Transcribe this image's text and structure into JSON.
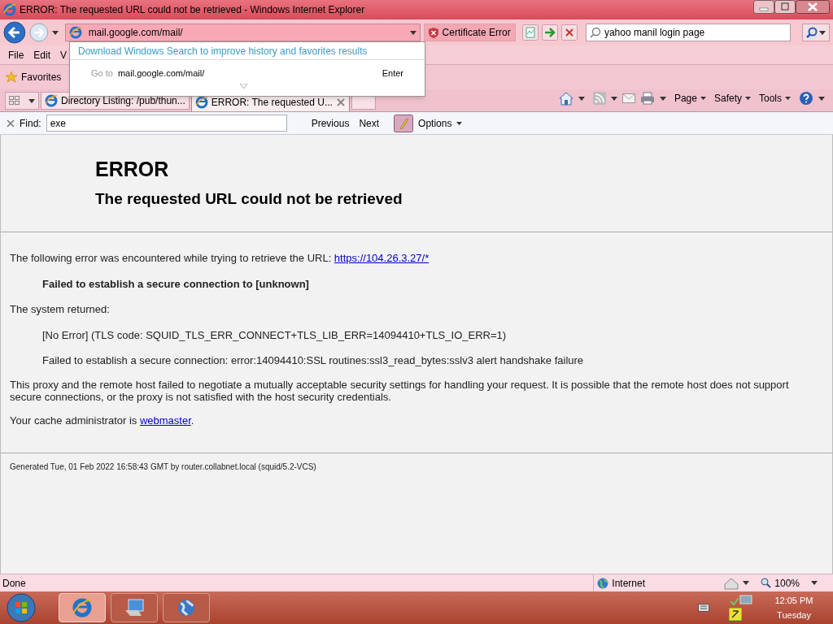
{
  "window": {
    "title": "ERROR: The requested URL could not be retrieved - Windows Internet Explorer"
  },
  "address_bar": {
    "value": "mail.google.com/mail/",
    "certificate": "Certificate Error"
  },
  "search": {
    "value": "yahoo manil login page"
  },
  "autocomplete": {
    "hint": "Download Windows Search to improve history and favorites results",
    "goto_label": "Go to",
    "goto_url": "mail.google.com/mail/",
    "enter": "Enter"
  },
  "menu": [
    "File",
    "Edit",
    "V"
  ],
  "favorites": {
    "label": "Favorites"
  },
  "tabs": [
    {
      "label": "Directory Listing: /pub/thun...",
      "selected": false
    },
    {
      "label": "ERROR: The requested U...",
      "selected": true
    }
  ],
  "command_bar": [
    "Page",
    "Safety",
    "Tools"
  ],
  "find": {
    "label": "Find:",
    "value": "exe",
    "previous": "Previous",
    "next": "Next",
    "options": "Options"
  },
  "page": {
    "heading": "ERROR",
    "subheading": "The requested URL could not be retrieved",
    "intro": {
      "text": "The following error was encountered while trying to retrieve the URL:",
      "link": "https://104.26.3.27/*"
    },
    "error": "Failed to establish a secure connection to [unknown]",
    "returned": "The system returned:",
    "details": [
      "[No Error] (TLS code: SQUID_TLS_ERR_CONNECT+TLS_LIB_ERR=14094410+TLS_IO_ERR=1)",
      "Failed to establish a secure connection: error:14094410:SSL routines:ssl3_read_bytes:sslv3 alert handshake failure"
    ],
    "explanation": "This proxy and the remote host failed to negotiate a mutually acceptable security settings for handling your request. It is possible that the remote host does not support secure connections, or the proxy is not satisfied with the host security credentials.",
    "admin": {
      "text": "Your cache administrator is",
      "link": "webmaster",
      "end": "."
    },
    "footer": "Generated Tue, 01 Feb 2022 16:58:43 GMT by router.collabnet.local (squid/5.2-VCS)"
  },
  "status_bar": {
    "text": "Done",
    "zone": "Internet",
    "zoom": "100%"
  },
  "taskbar": {
    "buttons": [
      {
        "kind": "browser",
        "selected": true
      },
      {
        "kind": "computer",
        "selected": false
      },
      {
        "kind": "globe",
        "selected": false
      }
    ],
    "time": "12:05 PM",
    "day": "Tuesday"
  }
}
